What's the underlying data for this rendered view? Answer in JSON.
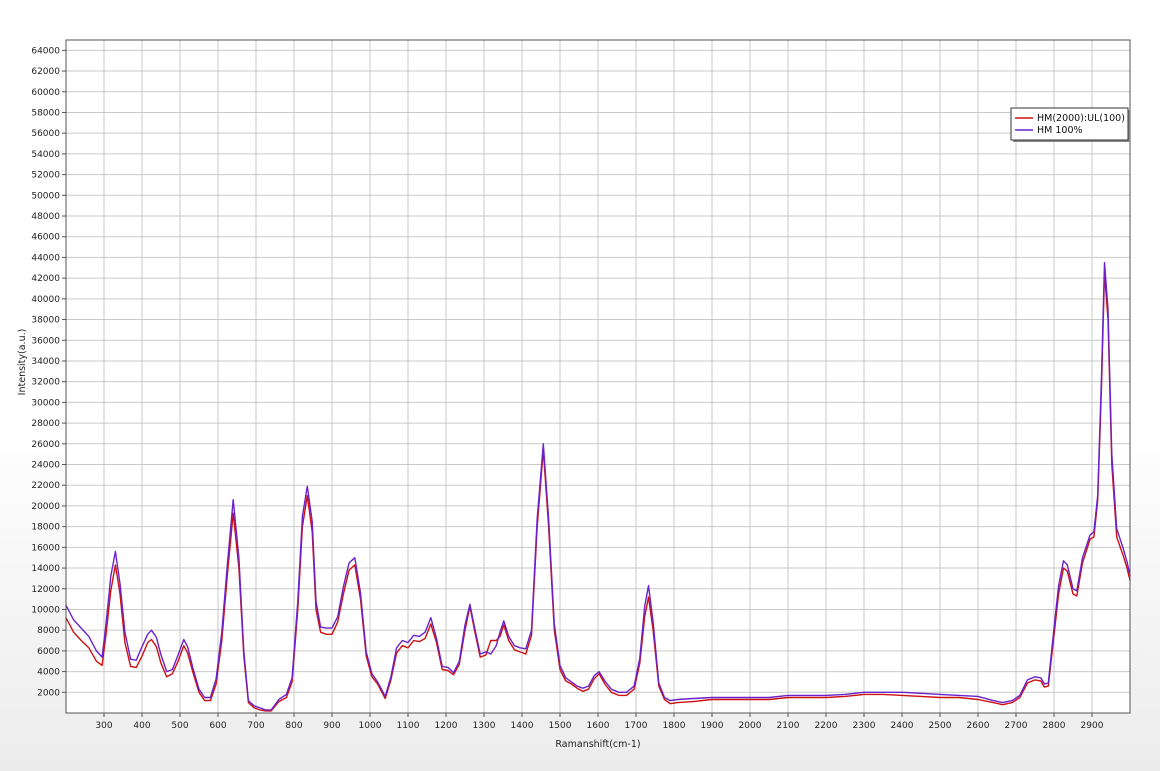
{
  "chart_data": {
    "type": "line",
    "title": "",
    "xlabel": "Ramanshift(cm-1)",
    "ylabel": "Intensity(a.u.)",
    "xlim": [
      200,
      3000
    ],
    "ylim": [
      0,
      65000
    ],
    "xticks": [
      300,
      400,
      500,
      600,
      700,
      800,
      900,
      1000,
      1100,
      1200,
      1300,
      1400,
      1500,
      1600,
      1700,
      1800,
      1900,
      2000,
      2100,
      2200,
      2300,
      2400,
      2500,
      2600,
      2700,
      2800,
      2900
    ],
    "yticks": [
      2000,
      4000,
      6000,
      8000,
      10000,
      12000,
      14000,
      16000,
      18000,
      20000,
      22000,
      24000,
      26000,
      28000,
      30000,
      32000,
      34000,
      36000,
      38000,
      40000,
      42000,
      44000,
      46000,
      48000,
      50000,
      52000,
      54000,
      56000,
      58000,
      60000,
      62000,
      64000
    ],
    "grid": true,
    "legend_position": "top-right",
    "series": [
      {
        "name": "HM(2000):UL(100)",
        "color": "#cc1111",
        "points": [
          [
            200,
            9200
          ],
          [
            220,
            7800
          ],
          [
            240,
            7000
          ],
          [
            260,
            6300
          ],
          [
            280,
            5000
          ],
          [
            295,
            4600
          ],
          [
            305,
            7500
          ],
          [
            318,
            11800
          ],
          [
            330,
            14300
          ],
          [
            342,
            11500
          ],
          [
            355,
            6800
          ],
          [
            370,
            4500
          ],
          [
            385,
            4400
          ],
          [
            400,
            5500
          ],
          [
            415,
            6800
          ],
          [
            425,
            7100
          ],
          [
            438,
            6400
          ],
          [
            450,
            4800
          ],
          [
            465,
            3500
          ],
          [
            480,
            3800
          ],
          [
            495,
            5000
          ],
          [
            510,
            6500
          ],
          [
            520,
            5800
          ],
          [
            535,
            3800
          ],
          [
            550,
            2000
          ],
          [
            565,
            1200
          ],
          [
            580,
            1200
          ],
          [
            595,
            2800
          ],
          [
            610,
            7000
          ],
          [
            625,
            13500
          ],
          [
            640,
            19300
          ],
          [
            655,
            14000
          ],
          [
            668,
            5500
          ],
          [
            680,
            1000
          ],
          [
            695,
            500
          ],
          [
            710,
            300
          ],
          [
            725,
            200
          ],
          [
            740,
            200
          ],
          [
            760,
            1100
          ],
          [
            780,
            1500
          ],
          [
            795,
            3000
          ],
          [
            810,
            10000
          ],
          [
            822,
            18000
          ],
          [
            835,
            21000
          ],
          [
            848,
            17500
          ],
          [
            858,
            10000
          ],
          [
            870,
            7800
          ],
          [
            885,
            7600
          ],
          [
            900,
            7600
          ],
          [
            915,
            8800
          ],
          [
            930,
            11500
          ],
          [
            945,
            13800
          ],
          [
            960,
            14300
          ],
          [
            975,
            11000
          ],
          [
            990,
            5500
          ],
          [
            1005,
            3500
          ],
          [
            1020,
            2800
          ],
          [
            1040,
            1400
          ],
          [
            1055,
            3200
          ],
          [
            1070,
            5800
          ],
          [
            1085,
            6500
          ],
          [
            1100,
            6300
          ],
          [
            1115,
            7000
          ],
          [
            1130,
            6900
          ],
          [
            1145,
            7200
          ],
          [
            1160,
            8600
          ],
          [
            1175,
            6800
          ],
          [
            1190,
            4200
          ],
          [
            1205,
            4100
          ],
          [
            1220,
            3700
          ],
          [
            1235,
            4700
          ],
          [
            1250,
            8000
          ],
          [
            1263,
            10300
          ],
          [
            1275,
            8000
          ],
          [
            1290,
            5400
          ],
          [
            1305,
            5600
          ],
          [
            1318,
            7000
          ],
          [
            1332,
            7000
          ],
          [
            1342,
            7400
          ],
          [
            1352,
            8500
          ],
          [
            1365,
            7000
          ],
          [
            1380,
            6100
          ],
          [
            1395,
            5900
          ],
          [
            1410,
            5700
          ],
          [
            1425,
            7500
          ],
          [
            1440,
            18000
          ],
          [
            1456,
            25400
          ],
          [
            1470,
            18000
          ],
          [
            1485,
            8000
          ],
          [
            1500,
            4200
          ],
          [
            1515,
            3100
          ],
          [
            1530,
            2800
          ],
          [
            1545,
            2400
          ],
          [
            1560,
            2100
          ],
          [
            1575,
            2300
          ],
          [
            1590,
            3300
          ],
          [
            1603,
            3800
          ],
          [
            1618,
            2800
          ],
          [
            1635,
            2000
          ],
          [
            1655,
            1700
          ],
          [
            1675,
            1700
          ],
          [
            1695,
            2300
          ],
          [
            1710,
            4800
          ],
          [
            1723,
            9300
          ],
          [
            1733,
            11200
          ],
          [
            1745,
            8000
          ],
          [
            1760,
            2600
          ],
          [
            1775,
            1300
          ],
          [
            1790,
            900
          ],
          [
            1810,
            1000
          ],
          [
            1850,
            1100
          ],
          [
            1900,
            1300
          ],
          [
            1950,
            1300
          ],
          [
            2000,
            1300
          ],
          [
            2050,
            1300
          ],
          [
            2100,
            1500
          ],
          [
            2150,
            1500
          ],
          [
            2200,
            1500
          ],
          [
            2250,
            1600
          ],
          [
            2300,
            1800
          ],
          [
            2350,
            1800
          ],
          [
            2400,
            1700
          ],
          [
            2450,
            1600
          ],
          [
            2500,
            1500
          ],
          [
            2550,
            1500
          ],
          [
            2600,
            1300
          ],
          [
            2640,
            1000
          ],
          [
            2665,
            800
          ],
          [
            2690,
            1000
          ],
          [
            2710,
            1500
          ],
          [
            2730,
            2900
          ],
          [
            2750,
            3200
          ],
          [
            2765,
            3100
          ],
          [
            2775,
            2500
          ],
          [
            2785,
            2600
          ],
          [
            2800,
            7500
          ],
          [
            2812,
            11500
          ],
          [
            2825,
            14000
          ],
          [
            2835,
            13700
          ],
          [
            2850,
            11500
          ],
          [
            2860,
            11300
          ],
          [
            2875,
            14500
          ],
          [
            2895,
            16800
          ],
          [
            2905,
            17000
          ],
          [
            2915,
            20500
          ],
          [
            2925,
            31500
          ],
          [
            2933,
            42500
          ],
          [
            2942,
            38000
          ],
          [
            2952,
            24000
          ],
          [
            2965,
            17000
          ],
          [
            2982,
            15200
          ],
          [
            2992,
            14000
          ],
          [
            3000,
            12800
          ]
        ]
      },
      {
        "name": "HM 100%",
        "color": "#6a22cc",
        "points": [
          [
            200,
            10400
          ],
          [
            220,
            9000
          ],
          [
            240,
            8200
          ],
          [
            260,
            7400
          ],
          [
            280,
            6000
          ],
          [
            295,
            5400
          ],
          [
            305,
            8500
          ],
          [
            318,
            13200
          ],
          [
            330,
            15600
          ],
          [
            342,
            12500
          ],
          [
            355,
            7800
          ],
          [
            370,
            5200
          ],
          [
            385,
            5100
          ],
          [
            400,
            6400
          ],
          [
            415,
            7600
          ],
          [
            425,
            8000
          ],
          [
            438,
            7300
          ],
          [
            450,
            5600
          ],
          [
            465,
            4000
          ],
          [
            480,
            4200
          ],
          [
            495,
            5600
          ],
          [
            510,
            7100
          ],
          [
            520,
            6400
          ],
          [
            535,
            4200
          ],
          [
            550,
            2300
          ],
          [
            565,
            1500
          ],
          [
            580,
            1500
          ],
          [
            595,
            3300
          ],
          [
            610,
            7800
          ],
          [
            625,
            14500
          ],
          [
            640,
            20600
          ],
          [
            655,
            15000
          ],
          [
            668,
            6000
          ],
          [
            680,
            1200
          ],
          [
            695,
            700
          ],
          [
            710,
            500
          ],
          [
            725,
            300
          ],
          [
            740,
            300
          ],
          [
            760,
            1300
          ],
          [
            780,
            1800
          ],
          [
            795,
            3400
          ],
          [
            810,
            10800
          ],
          [
            822,
            19000
          ],
          [
            835,
            21900
          ],
          [
            848,
            18500
          ],
          [
            858,
            10800
          ],
          [
            870,
            8300
          ],
          [
            885,
            8200
          ],
          [
            900,
            8200
          ],
          [
            915,
            9300
          ],
          [
            930,
            12200
          ],
          [
            945,
            14500
          ],
          [
            960,
            15000
          ],
          [
            975,
            11600
          ],
          [
            990,
            5900
          ],
          [
            1005,
            3800
          ],
          [
            1020,
            3000
          ],
          [
            1040,
            1600
          ],
          [
            1055,
            3500
          ],
          [
            1070,
            6300
          ],
          [
            1085,
            7000
          ],
          [
            1100,
            6800
          ],
          [
            1115,
            7500
          ],
          [
            1130,
            7400
          ],
          [
            1145,
            7800
          ],
          [
            1160,
            9200
          ],
          [
            1175,
            7200
          ],
          [
            1190,
            4500
          ],
          [
            1205,
            4400
          ],
          [
            1220,
            3900
          ],
          [
            1235,
            5000
          ],
          [
            1250,
            8500
          ],
          [
            1263,
            10500
          ],
          [
            1275,
            8300
          ],
          [
            1290,
            5700
          ],
          [
            1305,
            5900
          ],
          [
            1318,
            5700
          ],
          [
            1332,
            6500
          ],
          [
            1342,
            7800
          ],
          [
            1352,
            8900
          ],
          [
            1365,
            7400
          ],
          [
            1380,
            6500
          ],
          [
            1395,
            6300
          ],
          [
            1410,
            6200
          ],
          [
            1425,
            8000
          ],
          [
            1440,
            18800
          ],
          [
            1456,
            26000
          ],
          [
            1470,
            18800
          ],
          [
            1485,
            8600
          ],
          [
            1500,
            4600
          ],
          [
            1515,
            3400
          ],
          [
            1530,
            3000
          ],
          [
            1545,
            2600
          ],
          [
            1560,
            2400
          ],
          [
            1575,
            2600
          ],
          [
            1590,
            3600
          ],
          [
            1603,
            4000
          ],
          [
            1618,
            3100
          ],
          [
            1635,
            2300
          ],
          [
            1655,
            2000
          ],
          [
            1675,
            2000
          ],
          [
            1695,
            2600
          ],
          [
            1710,
            5300
          ],
          [
            1723,
            10300
          ],
          [
            1733,
            12300
          ],
          [
            1745,
            8800
          ],
          [
            1760,
            2900
          ],
          [
            1775,
            1500
          ],
          [
            1790,
            1200
          ],
          [
            1810,
            1300
          ],
          [
            1850,
            1400
          ],
          [
            1900,
            1500
          ],
          [
            1950,
            1500
          ],
          [
            2000,
            1500
          ],
          [
            2050,
            1500
          ],
          [
            2100,
            1700
          ],
          [
            2150,
            1700
          ],
          [
            2200,
            1700
          ],
          [
            2250,
            1800
          ],
          [
            2300,
            2000
          ],
          [
            2350,
            2000
          ],
          [
            2400,
            2000
          ],
          [
            2450,
            1900
          ],
          [
            2500,
            1800
          ],
          [
            2550,
            1700
          ],
          [
            2600,
            1600
          ],
          [
            2640,
            1200
          ],
          [
            2665,
            1000
          ],
          [
            2690,
            1200
          ],
          [
            2710,
            1700
          ],
          [
            2730,
            3200
          ],
          [
            2750,
            3500
          ],
          [
            2765,
            3400
          ],
          [
            2775,
            2800
          ],
          [
            2785,
            2900
          ],
          [
            2800,
            8200
          ],
          [
            2812,
            12300
          ],
          [
            2825,
            14700
          ],
          [
            2835,
            14300
          ],
          [
            2850,
            12000
          ],
          [
            2860,
            11800
          ],
          [
            2875,
            15000
          ],
          [
            2895,
            17200
          ],
          [
            2905,
            17500
          ],
          [
            2915,
            21000
          ],
          [
            2925,
            32500
          ],
          [
            2933,
            43500
          ],
          [
            2942,
            39000
          ],
          [
            2952,
            25000
          ],
          [
            2965,
            17800
          ],
          [
            2982,
            15900
          ],
          [
            2992,
            14600
          ],
          [
            3000,
            13300
          ]
        ]
      }
    ]
  }
}
